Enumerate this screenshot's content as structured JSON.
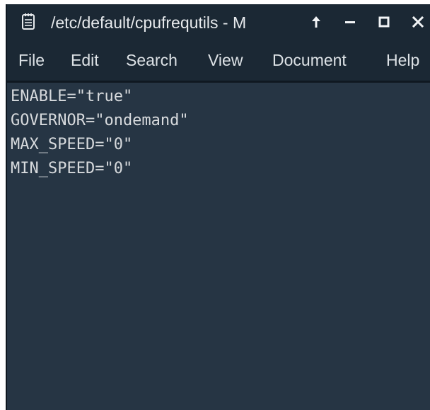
{
  "window": {
    "title": "/etc/default/cpufrequtils - M",
    "icon": "notepad-icon",
    "controls": {
      "keep_above_icon": "arrow-up-icon",
      "minimize_icon": "minimize-icon",
      "maximize_icon": "maximize-icon",
      "close_icon": "close-icon"
    }
  },
  "menubar": {
    "items": [
      {
        "label": "File"
      },
      {
        "label": "Edit"
      },
      {
        "label": "Search"
      },
      {
        "label": "View"
      },
      {
        "label": "Document"
      },
      {
        "label": "Help"
      }
    ]
  },
  "editor": {
    "lines": [
      "ENABLE=\"true\"",
      "GOVERNOR=\"ondemand\"",
      "MAX_SPEED=\"0\"",
      "MIN_SPEED=\"0\""
    ]
  },
  "colors": {
    "titlebar": "#1b2834",
    "editor_background": "#263544",
    "text": "#d7dadd"
  }
}
